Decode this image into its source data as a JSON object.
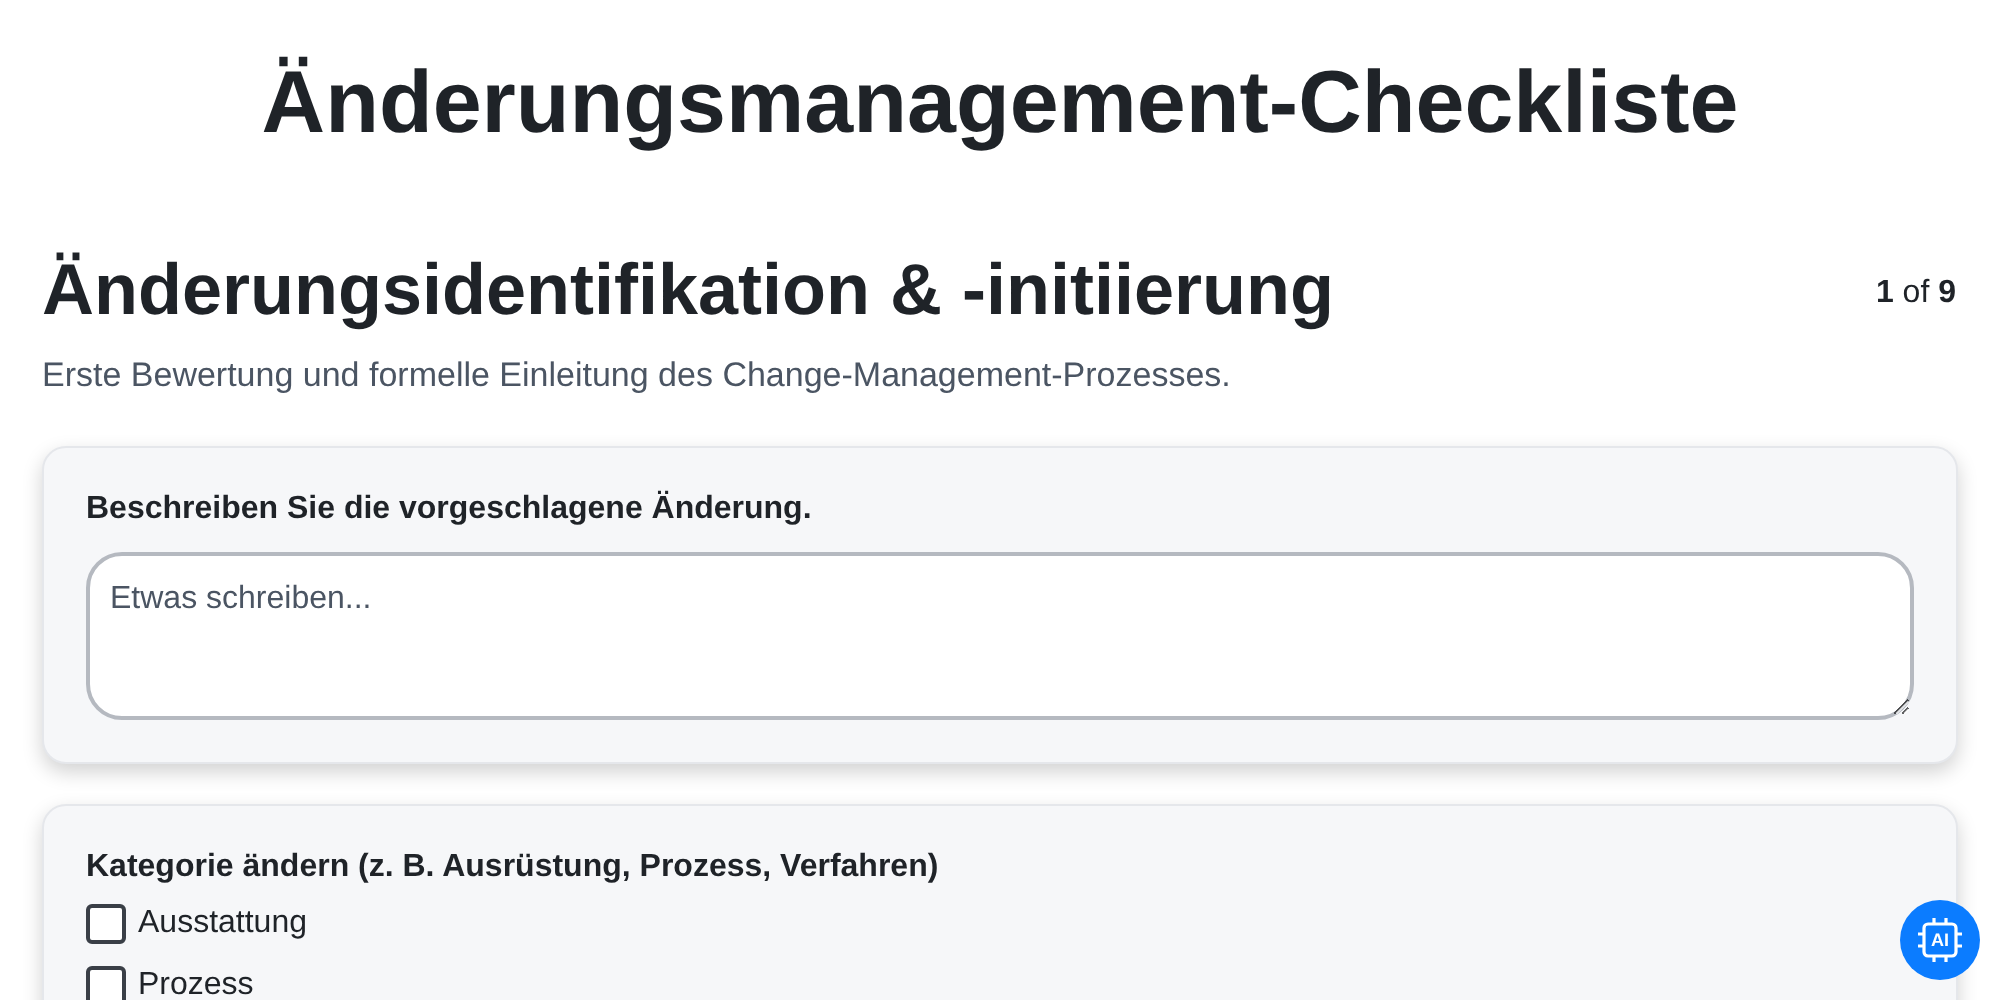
{
  "title": "Änderungsmanagement-Checkliste",
  "section": {
    "heading": "Änderungsidentifikation & -initiierung",
    "description": "Erste Bewertung und formelle Einleitung des Change-Management-Prozesses."
  },
  "counter": {
    "current": "1",
    "separator": "of",
    "total": "9"
  },
  "questions": [
    {
      "kind": "text",
      "label": "Beschreiben Sie die vorgeschlagene Änderung.",
      "placeholder": "Etwas schreiben..."
    },
    {
      "kind": "checkboxes",
      "label": "Kategorie ändern (z. B. Ausrüstung, Prozess, Verfahren)",
      "options": [
        {
          "label": "Ausstattung",
          "checked": false
        },
        {
          "label": "Prozess",
          "checked": false
        }
      ]
    }
  ],
  "assistant_button": {
    "label": "AI"
  }
}
